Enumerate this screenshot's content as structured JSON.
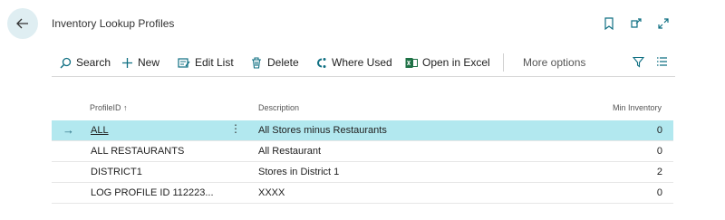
{
  "header": {
    "title": "Inventory Lookup Profiles"
  },
  "actions": {
    "search": "Search",
    "new": "New",
    "edit_list": "Edit List",
    "delete": "Delete",
    "where_used": "Where Used",
    "open_in_excel": "Open in Excel",
    "more_options": "More options"
  },
  "table": {
    "columns": {
      "profile_id": "ProfileID ↑",
      "description": "Description",
      "min_inventory": "Min Inventory"
    },
    "rows": [
      {
        "profile_id": "ALL",
        "description": "All Stores minus Restaurants",
        "min_inventory": "0",
        "selected": true
      },
      {
        "profile_id": "ALL RESTAURANTS",
        "description": "All Restaurant",
        "min_inventory": "0"
      },
      {
        "profile_id": "DISTRICT1",
        "description": "Stores in District 1",
        "min_inventory": "2"
      },
      {
        "profile_id": "LOG PROFILE ID 112223...",
        "description": "XXXX",
        "min_inventory": "0"
      }
    ]
  },
  "colors": {
    "accent": "#0f6f82",
    "selected_row": "#b2e8ef",
    "excel_green": "#1e7145"
  }
}
